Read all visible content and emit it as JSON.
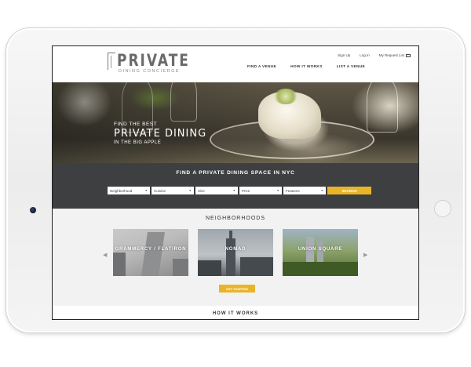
{
  "logo": {
    "title": "PRIVATE",
    "subtitle": "DINING CONCIERGE"
  },
  "top_links": {
    "signup": "Sign Up",
    "login": "Log In",
    "request_list": "My Request List"
  },
  "nav": {
    "find_venue": "FIND A VENUE",
    "how_it_works": "HOW IT WORKS",
    "list_venue": "LIST A VENUE"
  },
  "hero": {
    "line1": "FIND THE BEST",
    "line2": "PRIVATE DINING",
    "line3": "IN THE BIG APPLE"
  },
  "search": {
    "title": "FIND A PRIVATE DINING SPACE IN NYC",
    "filters": [
      "Neighborhood",
      "Cuisine",
      "Size",
      "Price",
      "Features"
    ],
    "button": "SEARCH"
  },
  "neighborhoods": {
    "title": "NEIGHBORHOODS",
    "cards": [
      "GRAMMERCY / FLATIRON",
      "NOMAD",
      "UNION SQUARE"
    ],
    "cta": "GET STARTED"
  },
  "how_section": {
    "title": "HOW IT WORKS"
  },
  "colors": {
    "accent": "#e9b526",
    "band": "#3d3f40",
    "section_bg": "#f2f2f2"
  }
}
